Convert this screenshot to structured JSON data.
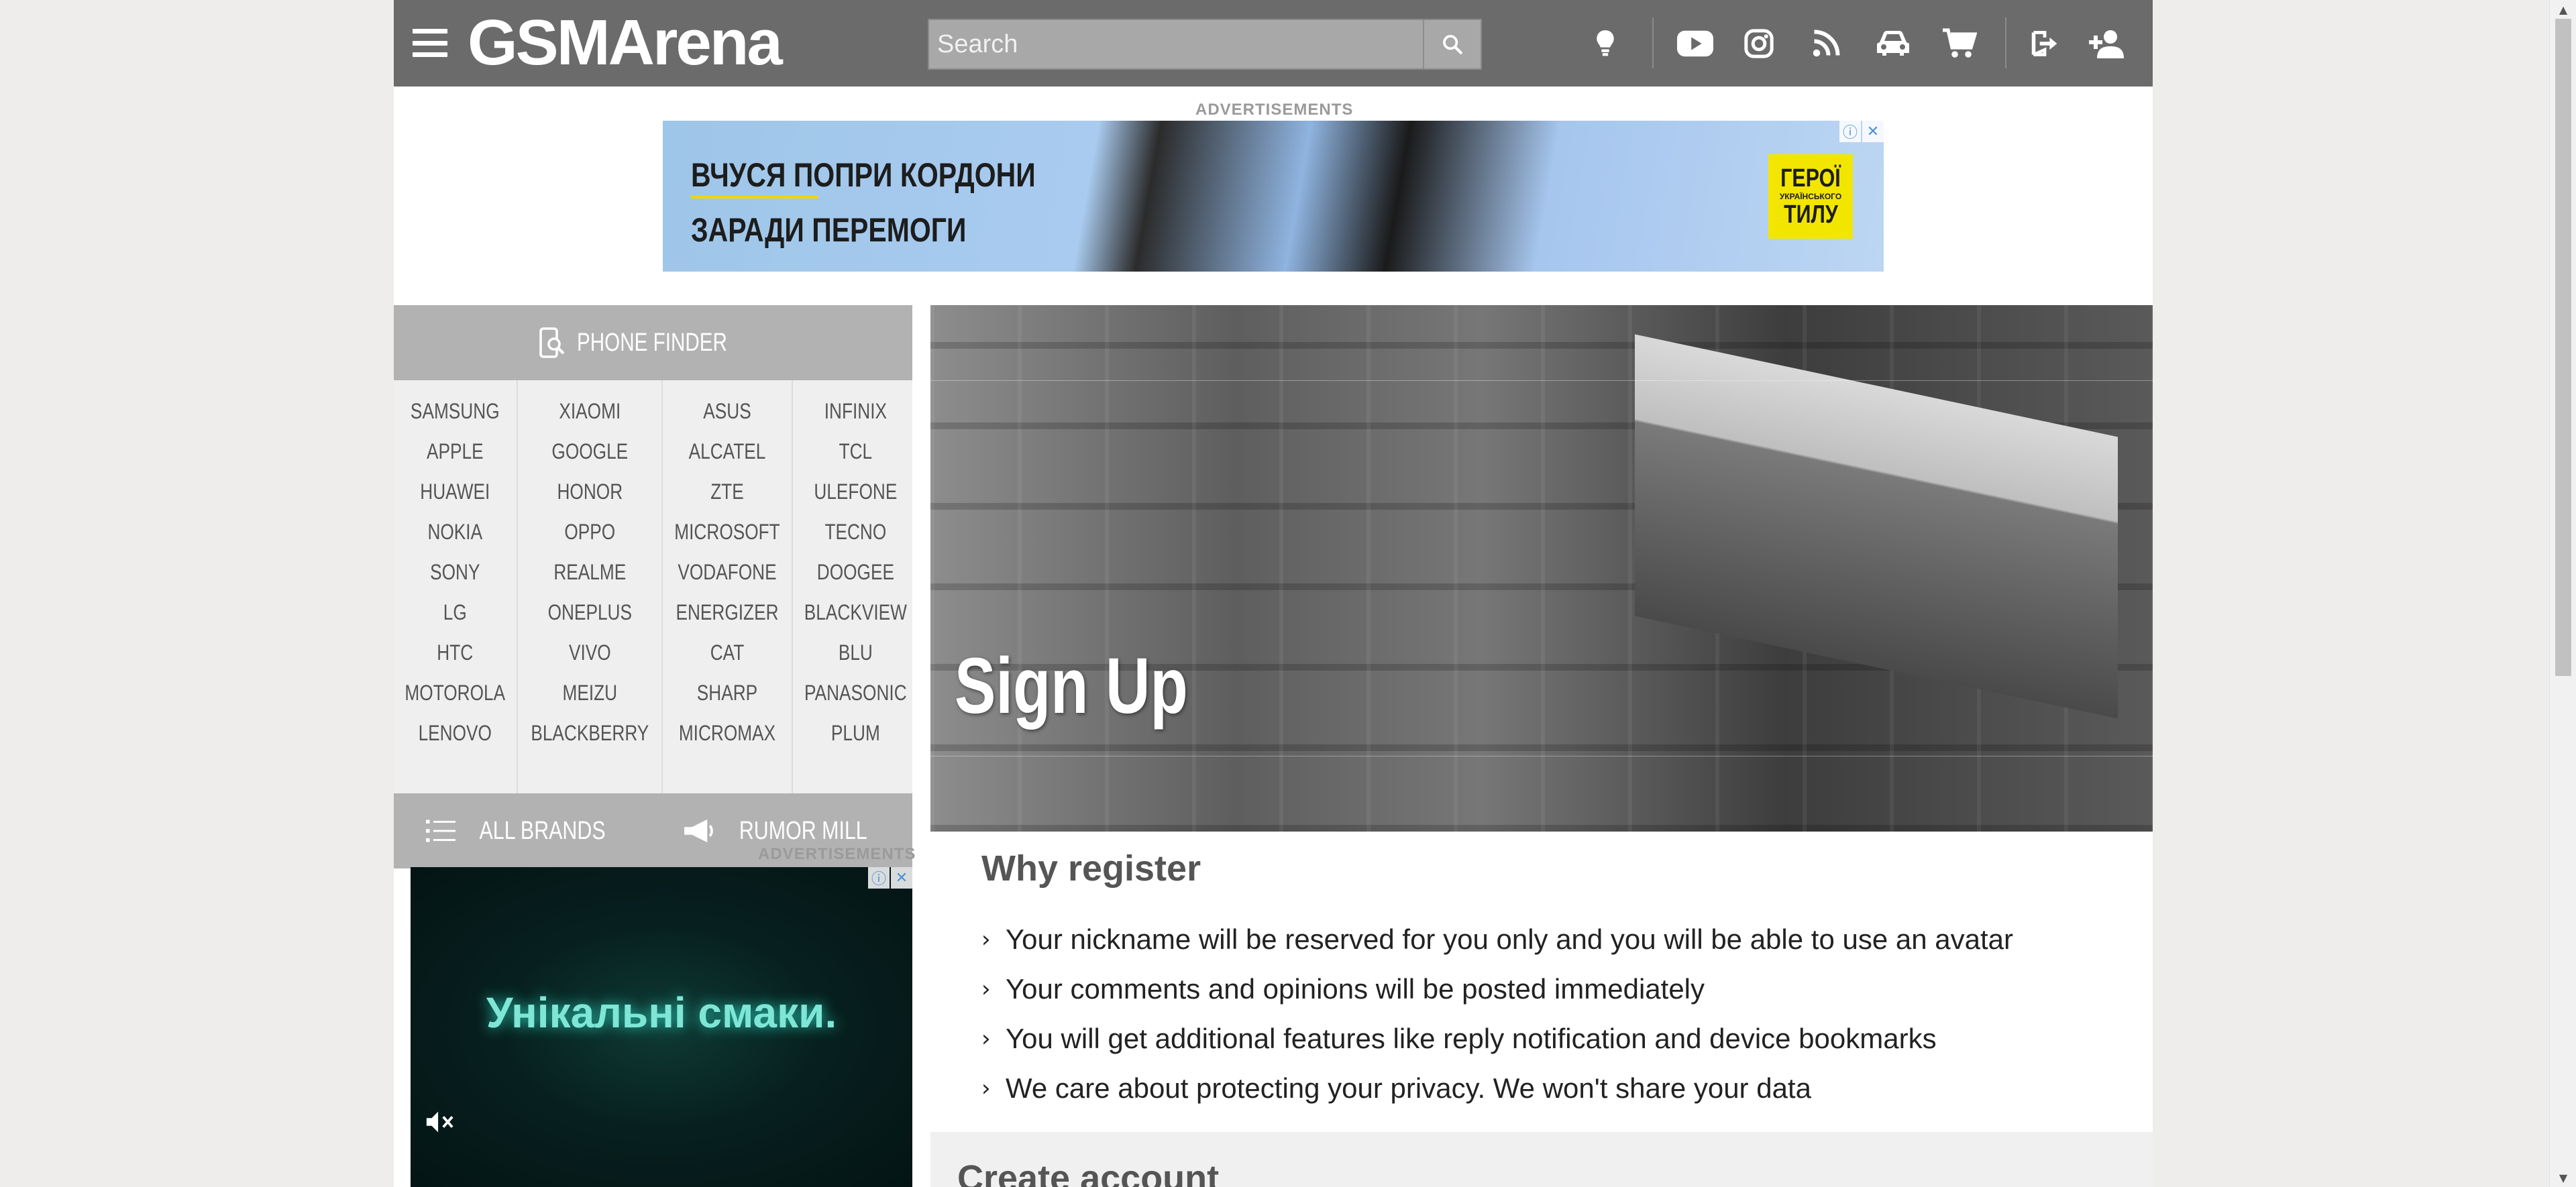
{
  "header": {
    "logo": "GSMArena",
    "search_placeholder": "Search"
  },
  "top_ad": {
    "label": "ADVERTISEMENTS",
    "line1": "ВЧУСЯ ПОПРИ КОРДОНИ",
    "line2": "ЗАРАДИ ПЕРЕМОГИ",
    "badge_line1": "ГЕРОЇ",
    "badge_line2": "УКРАЇНСЬКОГО",
    "badge_line3": "ТИЛУ"
  },
  "sidebar": {
    "phone_finder": "PHONE FINDER",
    "brand_columns": [
      [
        "SAMSUNG",
        "APPLE",
        "HUAWEI",
        "NOKIA",
        "SONY",
        "LG",
        "HTC",
        "MOTOROLA",
        "LENOVO"
      ],
      [
        "XIAOMI",
        "GOOGLE",
        "HONOR",
        "OPPO",
        "REALME",
        "ONEPLUS",
        "VIVO",
        "MEIZU",
        "BLACKBERRY"
      ],
      [
        "ASUS",
        "ALCATEL",
        "ZTE",
        "MICROSOFT",
        "VODAFONE",
        "ENERGIZER",
        "CAT",
        "SHARP",
        "MICROMAX"
      ],
      [
        "INFINIX",
        "TCL",
        "ULEFONE",
        "TECNO",
        "DOOGEE",
        "BLACKVIEW",
        "BLU",
        "PANASONIC",
        "PLUM"
      ]
    ],
    "all_brands": "ALL BRANDS",
    "rumor_mill": "RUMOR MILL",
    "ad_label": "ADVERTISEMENTS",
    "ad_text": "Унікальні смаки."
  },
  "main": {
    "hero_title": "Sign Up",
    "why_title": "Why register",
    "why_items": [
      "Your nickname will be reserved for you only and you will be able to use an avatar",
      "Your comments and opinions will be posted immediately",
      "You will get additional features like reply notification and device bookmarks",
      "We care about protecting your privacy. We won't share your data"
    ],
    "create_title": "Create account"
  },
  "icons": [
    "menu-icon",
    "search-icon",
    "tip-bulb-icon",
    "youtube-icon",
    "instagram-icon",
    "rss-icon",
    "car-icon",
    "cart-icon",
    "login-icon",
    "add-user-icon"
  ],
  "colors": {
    "header_bg": "#6b6b6b",
    "search_bg": "#a8a8a8",
    "bar_bg": "#b2b2b2",
    "brands_bg": "#efefef",
    "page_bg": "#efedeb"
  }
}
